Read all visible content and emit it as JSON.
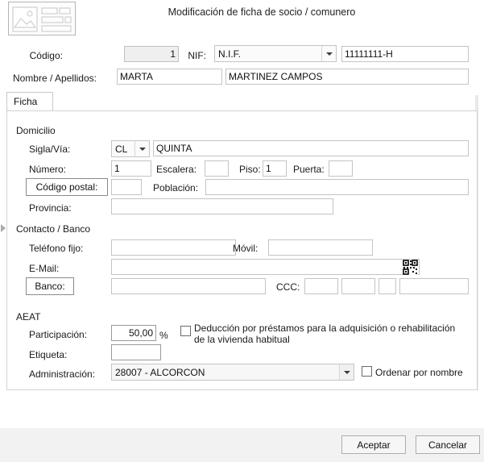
{
  "dialog": {
    "title": "Modificación de ficha de socio / comunero",
    "icon": "form-photo-icon"
  },
  "top": {
    "codigo_label": "Código:",
    "codigo_value": "1",
    "nif_label": "NIF:",
    "nif_type_value": "N.I.F.",
    "nif_value": "11111111-H",
    "nombre_label": "Nombre / Apellidos:",
    "nombre_value": "MARTA",
    "apellidos_value": "MARTINEZ CAMPOS"
  },
  "tabs": [
    {
      "label": "Ficha",
      "selected": true
    }
  ],
  "domicilio": {
    "group_label": "Domicilio",
    "sigla_label": "Sigla/Vía:",
    "sigla_value": "CL",
    "via_value": "QUINTA",
    "numero_label": "Número:",
    "numero_value": "1",
    "escalera_label": "Escalera:",
    "escalera_value": "",
    "piso_label": "Piso:",
    "piso_value": "1",
    "puerta_label": "Puerta:",
    "puerta_value": "",
    "codigo_postal_label": "Código postal:",
    "codigo_postal_value": "",
    "poblacion_label": "Población:",
    "poblacion_value": "",
    "provincia_label": "Provincia:",
    "provincia_value": ""
  },
  "contacto": {
    "group_label": "Contacto / Banco",
    "telefono_label": "Teléfono fijo:",
    "telefono_value": "",
    "movil_label": "Móvil:",
    "movil_value": "",
    "email_label": "E-Mail:",
    "email_value": "",
    "qr_icon": "qr-code-icon",
    "banco_label": "Banco:",
    "banco_value": "",
    "ccc_label": "CCC:",
    "ccc_values": [
      "",
      "",
      "",
      ""
    ]
  },
  "aeat": {
    "group_label": "AEAT",
    "participacion_label": "Participación:",
    "participacion_value": "50,00",
    "participacion_unit": "%",
    "deduccion_checkbox_label": "Deducción por préstamos para la adquisición o rehabilitación de la vivienda habitual",
    "deduccion_checked": false,
    "etiqueta_label": "Etiqueta:",
    "etiqueta_value": "",
    "administracion_label": "Administración:",
    "administracion_value": "28007 - ALCORCON",
    "ordenar_checkbox_label": "Ordenar por nombre",
    "ordenar_checked": false
  },
  "footer": {
    "accept_label": "Aceptar",
    "cancel_label": "Cancelar"
  },
  "colors": {
    "panel_border": "#d2d2d2",
    "field_border": "#c4c4c4",
    "readonly_bg": "#efefef",
    "footer_bg": "#f2f2f2"
  }
}
